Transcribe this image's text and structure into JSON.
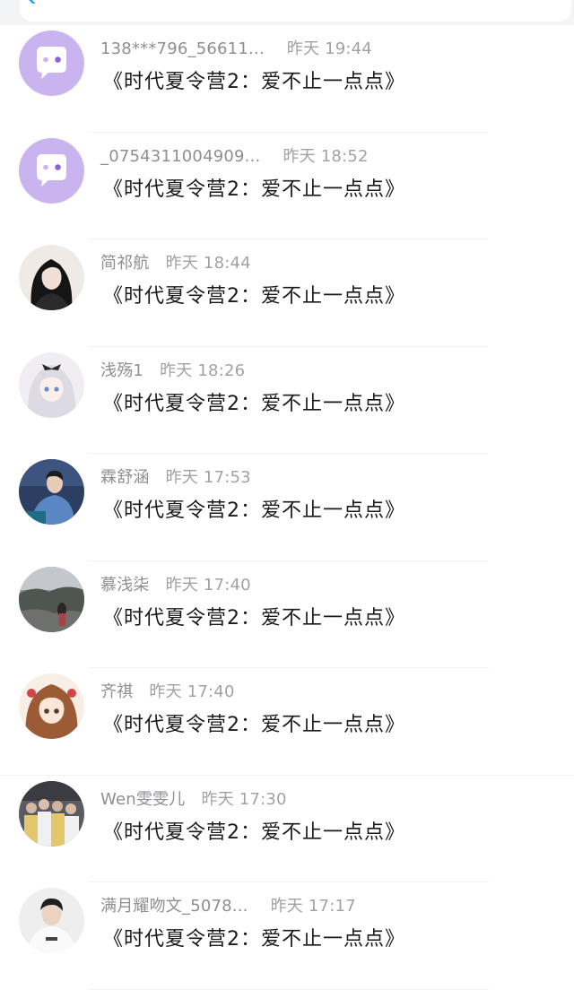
{
  "messages": [
    {
      "name": "138***796_56611...",
      "time": "昨天 19:44",
      "text": "《时代夏令营2：爱不止一点点》",
      "avatar": "default-chat-avatar"
    },
    {
      "name": "_0754311004909...",
      "time": "昨天 18:52",
      "text": "《时代夏令营2：爱不止一点点》",
      "avatar": "default-chat-avatar"
    },
    {
      "name": "简祁航",
      "time": "昨天 18:44",
      "text": "《时代夏令营2：爱不止一点点》",
      "avatar": "photo-dark-hair-girl"
    },
    {
      "name": "浅殇1",
      "time": "昨天 18:26",
      "text": "《时代夏令营2：爱不止一点点》",
      "avatar": "anime-silver-hair-girl"
    },
    {
      "name": "霖舒涵",
      "time": "昨天 17:53",
      "text": "《时代夏令营2：爱不止一点点》",
      "avatar": "photo-blue-shirt-boy"
    },
    {
      "name": "慕浅柒",
      "time": "昨天 17:40",
      "text": "《时代夏令营2：爱不止一点点》",
      "avatar": "photo-grey-landscape"
    },
    {
      "name": "齐祺",
      "time": "昨天 17:40",
      "text": "《时代夏令营2：爱不止一点点》",
      "avatar": "anime-brown-hair-girl"
    },
    {
      "name": "Wen雯雯儿",
      "time": "昨天 17:30",
      "text": "《时代夏令营2：爱不止一点点》",
      "avatar": "photo-group"
    },
    {
      "name": "满月耀吻文_5078...",
      "time": "昨天 17:17",
      "text": "《时代夏令营2：爱不止一点点》",
      "avatar": "photo-white-shirt-boy"
    }
  ],
  "colors": {
    "default_avatar_bg": "#c9b4ef",
    "name_text": "#8e8e93",
    "message_text": "#1a1a1a",
    "divider": "#f2f2f2"
  }
}
